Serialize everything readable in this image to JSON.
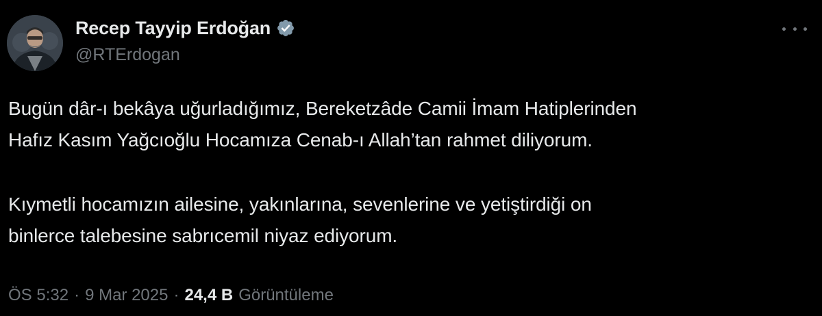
{
  "author": {
    "display_name": "Recep Tayyip Erdoğan",
    "handle": "@RTErdogan",
    "verified_icon": "verified-badge-icon",
    "avatar_icon": "profile-photo"
  },
  "menu": {
    "icon": "more-options-icon"
  },
  "tweet": {
    "paragraph1_line1": "Bugün dâr-ı bekâya uğurladığımız, Bereketzâde Camii İmam Hatiplerinden",
    "paragraph1_line2": "Hafız Kasım Yağcıoğlu Hocamıza Cenab-ı Allah’tan rahmet diliyorum.",
    "paragraph2_line1": "Kıymetli hocamızın ailesine, yakınlarına, sevenlerine ve yetiştirdiği on",
    "paragraph2_line2": "binlerce talebesine sabrıcemil niyaz ediyorum."
  },
  "meta": {
    "time": "ÖS 5:32",
    "separator": "·",
    "date": "9 Mar 2025",
    "views_count": "24,4 B",
    "views_label": "Görüntüleme"
  },
  "colors": {
    "background": "#000000",
    "text_primary": "#e7e9ea",
    "text_secondary": "#71767b",
    "verified_badge": "#829aab"
  }
}
